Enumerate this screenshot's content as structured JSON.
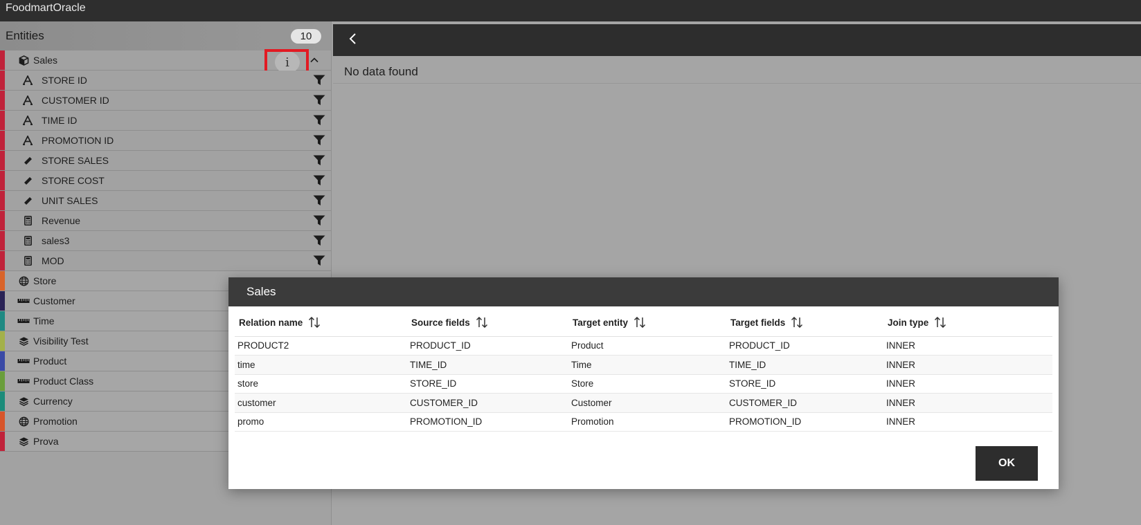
{
  "app": {
    "title": "FoodmartOracle"
  },
  "sidebar": {
    "title": "Entities",
    "count": "10",
    "expanded_entity": {
      "name": "Sales",
      "color": "#c0223a",
      "info_label": "i",
      "fields": [
        {
          "label": "STORE ID",
          "icon": "text-attribute-icon"
        },
        {
          "label": "CUSTOMER ID",
          "icon": "text-attribute-icon"
        },
        {
          "label": "TIME ID",
          "icon": "text-attribute-icon"
        },
        {
          "label": "PROMOTION ID",
          "icon": "text-attribute-icon"
        },
        {
          "label": "STORE SALES",
          "icon": "ruler-measure-icon"
        },
        {
          "label": "STORE COST",
          "icon": "ruler-measure-icon"
        },
        {
          "label": "UNIT SALES",
          "icon": "ruler-measure-icon"
        },
        {
          "label": "Revenue",
          "icon": "calculator-icon"
        },
        {
          "label": "sales3",
          "icon": "calculator-icon"
        },
        {
          "label": "MOD",
          "icon": "calculator-icon"
        }
      ]
    },
    "entities": [
      {
        "label": "Store",
        "icon": "globe-icon",
        "color": "#d9642a"
      },
      {
        "label": "Customer",
        "icon": "ruler-icon",
        "color": "#2a2356"
      },
      {
        "label": "Time",
        "icon": "ruler-icon",
        "color": "#1f8a83"
      },
      {
        "label": "Visibility Test",
        "icon": "layers-icon",
        "color": "#a3b14a"
      },
      {
        "label": "Product",
        "icon": "ruler-icon",
        "color": "#3a4aa6"
      },
      {
        "label": "Product Class",
        "icon": "ruler-icon",
        "color": "#6a9e3b"
      },
      {
        "label": "Currency",
        "icon": "layers-icon",
        "color": "#1c8c7a"
      },
      {
        "label": "Promotion",
        "icon": "globe-icon",
        "color": "#d7552a"
      },
      {
        "label": "Prova",
        "icon": "layers-icon",
        "color": "#c0223a"
      }
    ]
  },
  "main": {
    "no_data_text": "No data found"
  },
  "modal": {
    "title": "Sales",
    "columns": [
      "Relation name",
      "Source fields",
      "Target entity",
      "Target fields",
      "Join type"
    ],
    "rows": [
      [
        "PRODUCT2",
        "PRODUCT_ID",
        "Product",
        "PRODUCT_ID",
        "INNER"
      ],
      [
        "time",
        "TIME_ID",
        "Time",
        "TIME_ID",
        "INNER"
      ],
      [
        "store",
        "STORE_ID",
        "Store",
        "STORE_ID",
        "INNER"
      ],
      [
        "customer",
        "CUSTOMER_ID",
        "Customer",
        "CUSTOMER_ID",
        "INNER"
      ],
      [
        "promo",
        "PROMOTION_ID",
        "Promotion",
        "PROMOTION_ID",
        "INNER"
      ]
    ],
    "ok_label": "OK"
  }
}
